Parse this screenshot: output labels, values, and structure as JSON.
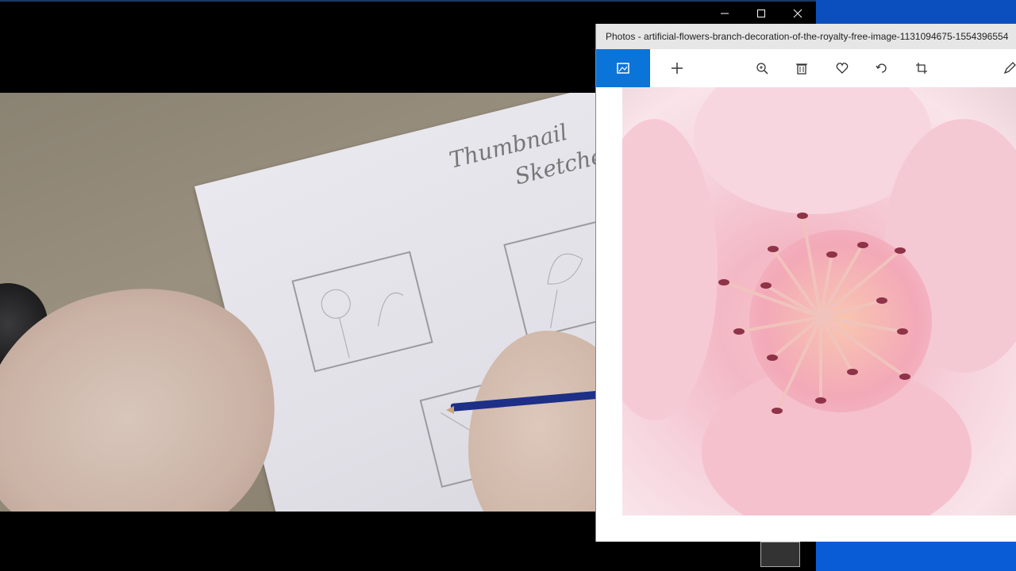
{
  "video_window": {
    "caption_buttons": [
      "minimize",
      "maximize",
      "close"
    ],
    "paper_text_line1": "Thumbnail",
    "paper_text_line2": "Sketches"
  },
  "photos_window": {
    "title": "Photos - artificial-flowers-branch-decoration-of-the-royalty-free-image-1131094675-1554396554",
    "toolbar": {
      "icons": [
        "gallery-icon",
        "add-icon",
        "zoom-in-icon",
        "delete-icon",
        "favorite-icon",
        "rotate-icon",
        "crop-icon",
        "edit-icon"
      ]
    }
  },
  "colors": {
    "accent": "#0a74d9",
    "desktop": "#0a5cd6"
  }
}
